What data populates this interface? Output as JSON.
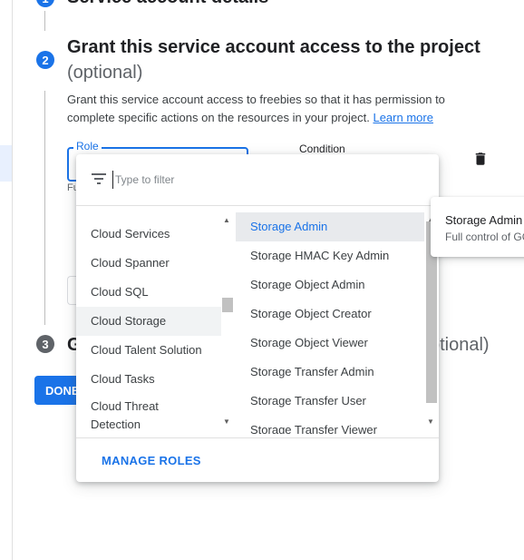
{
  "step1": {
    "number": "1",
    "title": "Service account details"
  },
  "step2": {
    "number": "2",
    "title": "Grant this service account access to the project",
    "optional": "(optional)",
    "description": "Grant this service account access to freebies so that it has permission to complete specific actions on the resources in your project.",
    "learn_more": "Learn more",
    "role_label": "Role",
    "role_hint": "Fu",
    "condition_label": "Condition"
  },
  "step3": {
    "number": "3",
    "title_partial": "G",
    "optional_partial": "ptional)"
  },
  "done_button": "DONE",
  "role_picker": {
    "filter_placeholder": "Type to filter",
    "categories": [
      "Cloud Services",
      "Cloud Spanner",
      "Cloud SQL",
      "Cloud Storage",
      "Cloud Talent Solution",
      "Cloud Tasks",
      "Cloud Threat Detection"
    ],
    "selected_category": "Cloud Storage",
    "roles": [
      "Storage Admin",
      "Storage HMAC Key Admin",
      "Storage Object Admin",
      "Storage Object Creator",
      "Storage Object Viewer",
      "Storage Transfer Admin",
      "Storage Transfer User",
      "Storage Transfer Viewer"
    ],
    "selected_role": "Storage Admin",
    "manage_roles": "MANAGE ROLES"
  },
  "tooltip": {
    "title": "Storage Admin",
    "description": "Full control of GC"
  },
  "colors": {
    "accent": "#1a73e8",
    "selected_bg": "#e8eaed",
    "category_selected_bg": "#f1f3f4"
  }
}
